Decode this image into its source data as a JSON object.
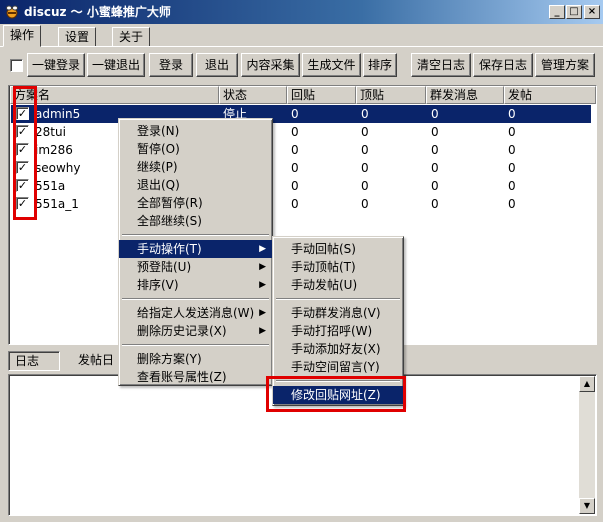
{
  "window": {
    "title": "discuz ～ 小蜜蜂推广大师",
    "icon": "bee-app-icon",
    "controls": [
      "_",
      "□",
      "×"
    ]
  },
  "tabs": [
    "操作",
    "设置",
    "关于"
  ],
  "toolbar": {
    "left": [
      "一键登录",
      "一键退出",
      "登录",
      "退出",
      "内容采集",
      "生成文件",
      "排序"
    ],
    "right": [
      "清空日志",
      "保存日志",
      "管理方案"
    ]
  },
  "list": {
    "columns": [
      "方案名",
      "状态",
      "回贴",
      "顶贴",
      "群发消息",
      "发帖"
    ],
    "rows": [
      {
        "name": "admin5",
        "status": "停止",
        "reply": "0",
        "bump": "0",
        "mass": "0",
        "post": "0",
        "checked": true,
        "selected": true
      },
      {
        "name": "28tui",
        "status": "",
        "reply": "0",
        "bump": "0",
        "mass": "0",
        "post": "0",
        "checked": true,
        "selected": false
      },
      {
        "name": "im286",
        "status": "",
        "reply": "0",
        "bump": "0",
        "mass": "0",
        "post": "0",
        "checked": true,
        "selected": false
      },
      {
        "name": "seowhy",
        "status": "",
        "reply": "0",
        "bump": "0",
        "mass": "0",
        "post": "0",
        "checked": true,
        "selected": false
      },
      {
        "name": "551a",
        "status": "",
        "reply": "0",
        "bump": "0",
        "mass": "0",
        "post": "0",
        "checked": true,
        "selected": false
      },
      {
        "name": "551a_1",
        "status": "",
        "reply": "0",
        "bump": "0",
        "mass": "0",
        "post": "0",
        "checked": true,
        "selected": false
      }
    ]
  },
  "context_menu": {
    "group1": [
      "登录(N)",
      "暂停(O)",
      "继续(P)",
      "退出(Q)",
      "全部暂停(R)",
      "全部继续(S)"
    ],
    "group2": [
      "手动操作(T)",
      "预登陆(U)",
      "排序(V)"
    ],
    "group3": [
      "给指定人发送消息(W)",
      "删除历史记录(X)"
    ],
    "group4": [
      "删除方案(Y)",
      "查看账号属性(Z)"
    ]
  },
  "submenu": {
    "group1": [
      "手动回帖(S)",
      "手动顶帖(T)",
      "手动发帖(U)"
    ],
    "group2": [
      "手动群发消息(V)",
      "手动打招呼(W)",
      "手动添加好友(X)",
      "手动空间留言(Y)"
    ],
    "group3": [
      "修改回贴网址(Z)"
    ]
  },
  "log_tabs": [
    "日志",
    "发帖日"
  ],
  "colors": {
    "selection": "#0a246a",
    "annotation": "#e00000",
    "face": "#d4d0c8"
  }
}
